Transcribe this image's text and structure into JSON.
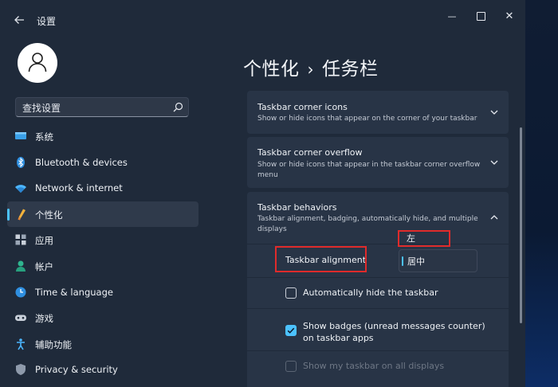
{
  "app": {
    "title": "设置"
  },
  "window_controls": {
    "minimize": "—",
    "close": "✕"
  },
  "search": {
    "placeholder": "查找设置"
  },
  "nav": {
    "items": [
      {
        "label": "系统"
      },
      {
        "label": "Bluetooth & devices"
      },
      {
        "label": "Network & internet"
      },
      {
        "label": "个性化"
      },
      {
        "label": "应用"
      },
      {
        "label": "帐户"
      },
      {
        "label": "Time & language"
      },
      {
        "label": "游戏"
      },
      {
        "label": "辅助功能"
      },
      {
        "label": "Privacy & security"
      }
    ]
  },
  "breadcrumb": {
    "parent": "个性化",
    "separator": "›",
    "current": "任务栏"
  },
  "sections": {
    "corner_icons": {
      "title": "Taskbar corner icons",
      "desc": "Show or hide icons that appear on the corner of your taskbar"
    },
    "corner_overflow": {
      "title": "Taskbar corner overflow",
      "desc": "Show or hide icons that appear in the taskbar corner overflow menu"
    },
    "behaviors": {
      "title": "Taskbar behaviors",
      "desc": "Taskbar alignment, badging, automatically hide, and multiple displays"
    }
  },
  "alignment": {
    "label": "Taskbar alignment",
    "option_left": "左",
    "option_center": "居中"
  },
  "options": {
    "auto_hide": {
      "label": "Automatically hide the taskbar",
      "checked": false
    },
    "badges": {
      "label_line1": "Show badges (unread messages counter)",
      "label_line2": "on taskbar apps",
      "checked": true
    },
    "all_displays": {
      "label": "Show my taskbar on all displays",
      "checked": false
    }
  },
  "colors": {
    "accent": "#4cc2ff",
    "highlight": "#e02b2b"
  }
}
